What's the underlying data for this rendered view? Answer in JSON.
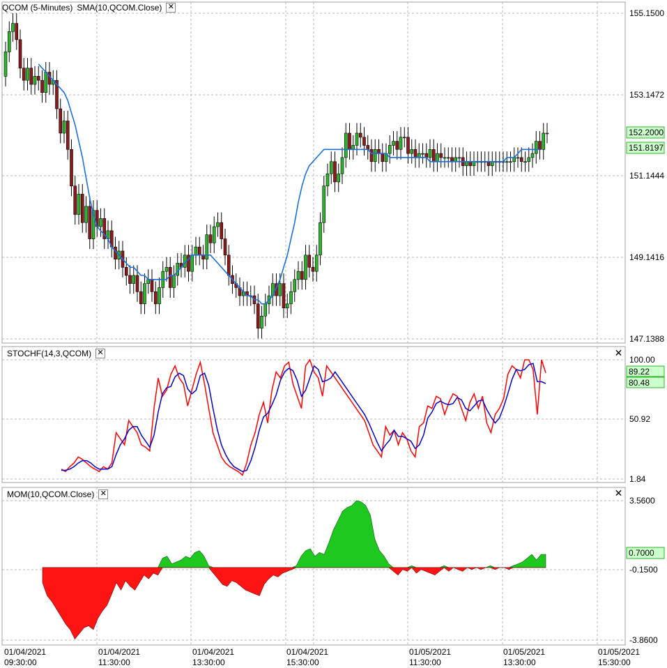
{
  "panels": {
    "price": {
      "title": "QCOM (5-Minutes)",
      "indicator_tab": "SMA(10,QCOM.Close)",
      "y_ticks": [
        "155.1500",
        "153.1472",
        "151.1444",
        "149.1416",
        "147.1388"
      ],
      "last_price_label": "152.2000",
      "sma_label": "151.8197"
    },
    "stoch": {
      "title": "STOCHF(14,3,QCOM)",
      "y_ticks": [
        "100.00",
        "50.92",
        "1.84"
      ],
      "k_label": "89.22",
      "d_label": "80.48"
    },
    "mom": {
      "title": "MOM(10,QCOM.Close)",
      "y_ticks": [
        "3.5600",
        "-0.1500",
        "-3.8600"
      ],
      "value_label": "0.7000"
    }
  },
  "x_axis": {
    "labels": [
      {
        "date": "01/04/2021",
        "time": "09:30:00"
      },
      {
        "date": "01/04/2021",
        "time": "11:30:00"
      },
      {
        "date": "01/04/2021",
        "time": "13:30:00"
      },
      {
        "date": "01/04/2021",
        "time": "15:30:00"
      },
      {
        "date": "01/05/2021",
        "time": "11:30:00"
      },
      {
        "date": "01/05/2021",
        "time": "13:30:00"
      },
      {
        "date": "01/05/2021",
        "time": "15:30:00"
      }
    ]
  },
  "colors": {
    "up_candle": "#2db52d",
    "down_candle": "#8b1a1a",
    "sma_line": "#1a6fe0",
    "stoch_k": "#ff0000",
    "stoch_d": "#0000cc",
    "mom_positive": "#1ec81e",
    "mom_negative": "#ff1414",
    "grid": "#b4b4b4",
    "label_bg": "#ccffcc"
  },
  "chart_data": [
    {
      "type": "candlestick",
      "title": "QCOM (5-Minutes)",
      "interval": "5-Minutes",
      "ylim": [
        147.1388,
        155.15
      ],
      "series_labels": [
        "QCOM (5-Minutes)",
        "SMA(10,QCOM.Close)"
      ],
      "close": [
        154.2,
        154.7,
        154.9,
        154.5,
        153.8,
        153.5,
        153.8,
        153.4,
        153.6,
        153.5,
        153.2,
        153.7,
        153.4,
        153.5,
        152.8,
        152.2,
        152.5,
        151.8,
        150.9,
        150.2,
        150.7,
        150.0,
        150.4,
        149.6,
        150.3,
        149.9,
        150.1,
        149.6,
        149.8,
        149.4,
        149.1,
        149.3,
        148.9,
        148.7,
        148.5,
        148.7,
        148.3,
        148.0,
        148.5,
        148.6,
        148.3,
        148.0,
        148.4,
        148.8,
        148.9,
        148.4,
        148.7,
        149.0,
        148.9,
        149.2,
        148.8,
        149.2,
        149.4,
        149.2,
        149.1,
        149.7,
        149.5,
        149.9,
        150.0,
        149.6,
        149.2,
        148.7,
        148.5,
        148.4,
        148.2,
        148.3,
        148.2,
        148.2,
        148.0,
        147.4,
        147.7,
        148.0,
        148.2,
        148.5,
        148.2,
        148.5,
        147.9,
        148.0,
        148.3,
        148.6,
        148.8,
        148.6,
        149.2,
        148.9,
        148.8,
        149.2,
        150.0,
        150.9,
        151.2,
        151.5,
        151.0,
        151.2,
        151.6,
        152.2,
        151.8,
        151.9,
        152.2,
        152.1,
        151.9,
        151.8,
        151.5,
        151.8,
        151.7,
        151.5,
        151.7,
        151.9,
        152.0,
        151.8,
        152.1,
        152.1,
        151.7,
        151.8,
        151.6,
        151.7,
        151.7,
        151.6,
        151.8,
        151.5,
        151.7,
        151.6,
        151.6,
        151.6,
        151.5,
        151.6,
        151.6,
        151.4,
        151.5,
        151.4,
        151.5,
        151.5,
        151.5,
        151.5,
        151.4,
        151.5,
        151.5,
        151.5,
        151.5,
        151.5,
        151.5,
        151.6,
        151.6,
        151.5,
        151.5,
        151.6,
        151.7,
        152.0,
        151.8,
        152.2,
        152.2
      ],
      "sma": [
        null,
        null,
        null,
        null,
        null,
        null,
        null,
        null,
        null,
        153.9,
        153.8,
        153.7,
        153.6,
        153.5,
        153.4,
        153.3,
        153.2,
        153.0,
        152.7,
        152.4,
        152.0,
        151.6,
        151.1,
        150.6,
        150.2,
        149.9,
        149.8,
        149.7,
        149.6,
        149.4,
        149.3,
        149.2,
        149.1,
        149.0,
        148.9,
        148.9,
        148.8,
        148.7,
        148.7,
        148.6,
        148.6,
        148.6,
        148.6,
        148.6,
        148.6,
        148.7,
        148.7,
        148.8,
        148.9,
        149.0,
        149.1,
        149.2,
        149.2,
        149.2,
        149.2,
        149.2,
        149.2,
        149.1,
        149.0,
        148.9,
        148.8,
        148.7,
        148.6,
        148.5,
        148.4,
        148.3,
        148.2,
        148.2,
        148.1,
        148.1,
        148.0,
        148.0,
        148.1,
        148.2,
        148.4,
        148.6,
        148.9,
        149.2,
        149.6,
        150.0,
        150.5,
        150.9,
        151.2,
        151.4,
        151.5,
        151.6,
        151.7,
        151.8,
        151.8,
        151.8,
        151.8,
        151.8,
        151.8,
        151.8,
        151.8,
        151.8,
        151.8,
        151.8,
        151.8,
        151.8,
        151.7,
        151.7,
        151.7,
        151.7,
        151.7,
        151.6,
        151.6,
        151.6,
        151.6,
        151.6,
        151.6,
        151.6,
        151.6,
        151.6,
        151.6,
        151.6,
        151.5,
        151.5,
        151.5,
        151.5,
        151.5,
        151.5,
        151.5,
        151.5,
        151.5,
        151.5,
        151.5,
        151.5,
        151.5,
        151.5,
        151.5,
        151.5,
        151.5,
        151.5,
        151.5,
        151.5,
        151.5,
        151.6,
        151.6,
        151.6,
        151.7,
        151.8,
        151.8,
        151.8,
        151.8,
        151.8,
        151.8
      ],
      "last_close": 152.2,
      "last_sma": 151.8197
    },
    {
      "type": "line",
      "title": "STOCHF(14,3,QCOM)",
      "ylim": [
        1.84,
        100.0
      ],
      "series": [
        {
          "name": "STOCHF %K",
          "values": [
            10,
            8,
            12,
            15,
            20,
            18,
            15,
            12,
            10,
            8,
            12,
            10,
            15,
            40,
            35,
            30,
            50,
            45,
            40,
            30,
            28,
            25,
            60,
            85,
            70,
            75,
            88,
            95,
            85,
            80,
            62,
            75,
            88,
            98,
            80,
            60,
            40,
            30,
            20,
            15,
            12,
            10,
            8,
            5,
            15,
            30,
            40,
            55,
            65,
            48,
            75,
            90,
            85,
            95,
            98,
            80,
            70,
            60,
            95,
            100,
            90,
            85,
            70,
            95,
            90,
            85,
            80,
            75,
            70,
            65,
            60,
            55,
            50,
            40,
            30,
            25,
            20,
            45,
            38,
            42,
            30,
            40,
            35,
            25,
            20,
            45,
            48,
            62,
            60,
            70,
            68,
            55,
            65,
            72,
            70,
            60,
            50,
            65,
            72,
            60,
            70,
            48,
            40,
            55,
            60,
            68,
            88,
            95,
            92,
            85,
            100,
            100,
            92,
            55,
            100,
            89.22
          ]
        },
        {
          "name": "STOCHF %D",
          "values": [
            9,
            9,
            10,
            12,
            15,
            17,
            17,
            15,
            12,
            10,
            10,
            10,
            12,
            22,
            30,
            35,
            42,
            45,
            45,
            38,
            33,
            28,
            38,
            57,
            72,
            77,
            78,
            86,
            89,
            87,
            76,
            72,
            75,
            87,
            89,
            79,
            60,
            43,
            30,
            22,
            16,
            12,
            10,
            8,
            9,
            17,
            28,
            42,
            53,
            56,
            63,
            71,
            83,
            90,
            93,
            91,
            83,
            70,
            75,
            85,
            95,
            92,
            82,
            83,
            85,
            90,
            85,
            80,
            75,
            70,
            65,
            60,
            55,
            48,
            40,
            32,
            25,
            30,
            34,
            42,
            37,
            37,
            35,
            33,
            27,
            30,
            38,
            52,
            57,
            64,
            66,
            64,
            63,
            64,
            69,
            67,
            60,
            58,
            62,
            66,
            67,
            59,
            53,
            48,
            52,
            61,
            72,
            84,
            92,
            91,
            92,
            96,
            97,
            82,
            82,
            80.48
          ]
        }
      ],
      "last_k": 89.22,
      "last_d": 80.48
    },
    {
      "type": "area",
      "title": "MOM(10,QCOM.Close)",
      "ylim": [
        -3.86,
        3.56
      ],
      "zero_line": 0,
      "values": [
        -0.8,
        -1.5,
        -1.8,
        -2.2,
        -2.6,
        -3.0,
        -3.3,
        -3.8,
        -3.5,
        -3.2,
        -3.1,
        -3.3,
        -2.7,
        -2.3,
        -2.0,
        -1.4,
        -0.8,
        -1.2,
        -0.7,
        -1.0,
        -1.2,
        -0.8,
        -0.4,
        -0.6,
        -0.3,
        -0.4,
        0.5,
        0.6,
        0.2,
        0.3,
        0.4,
        0.6,
        0.5,
        0.8,
        0.9,
        0.6,
        0.1,
        -0.3,
        -0.6,
        -0.9,
        -1.0,
        -0.7,
        -0.8,
        -1.0,
        -1.2,
        -1.3,
        -1.4,
        -1.5,
        -0.9,
        -0.6,
        -0.4,
        -0.5,
        -0.3,
        -0.2,
        -0.1,
        0.1,
        0.6,
        0.9,
        1.0,
        0.6,
        0.8,
        0.7,
        1.3,
        2.0,
        2.5,
        3.0,
        3.2,
        3.3,
        3.56,
        3.5,
        3.3,
        2.8,
        1.5,
        0.9,
        0.6,
        0.2,
        -0.2,
        -0.4,
        -0.1,
        -0.2,
        0.1,
        -0.3,
        -0.1,
        -0.2,
        -0.3,
        -0.4,
        -0.2,
        0.1,
        -0.2,
        0.0,
        -0.1,
        -0.2,
        0.0,
        -0.1,
        0.0,
        -0.1,
        0.0,
        0.1,
        -0.1,
        0.0,
        0.0,
        -0.1,
        0.1,
        0.2,
        0.3,
        0.5,
        0.7,
        0.4,
        0.7,
        0.7
      ],
      "last_value": 0.7
    }
  ]
}
